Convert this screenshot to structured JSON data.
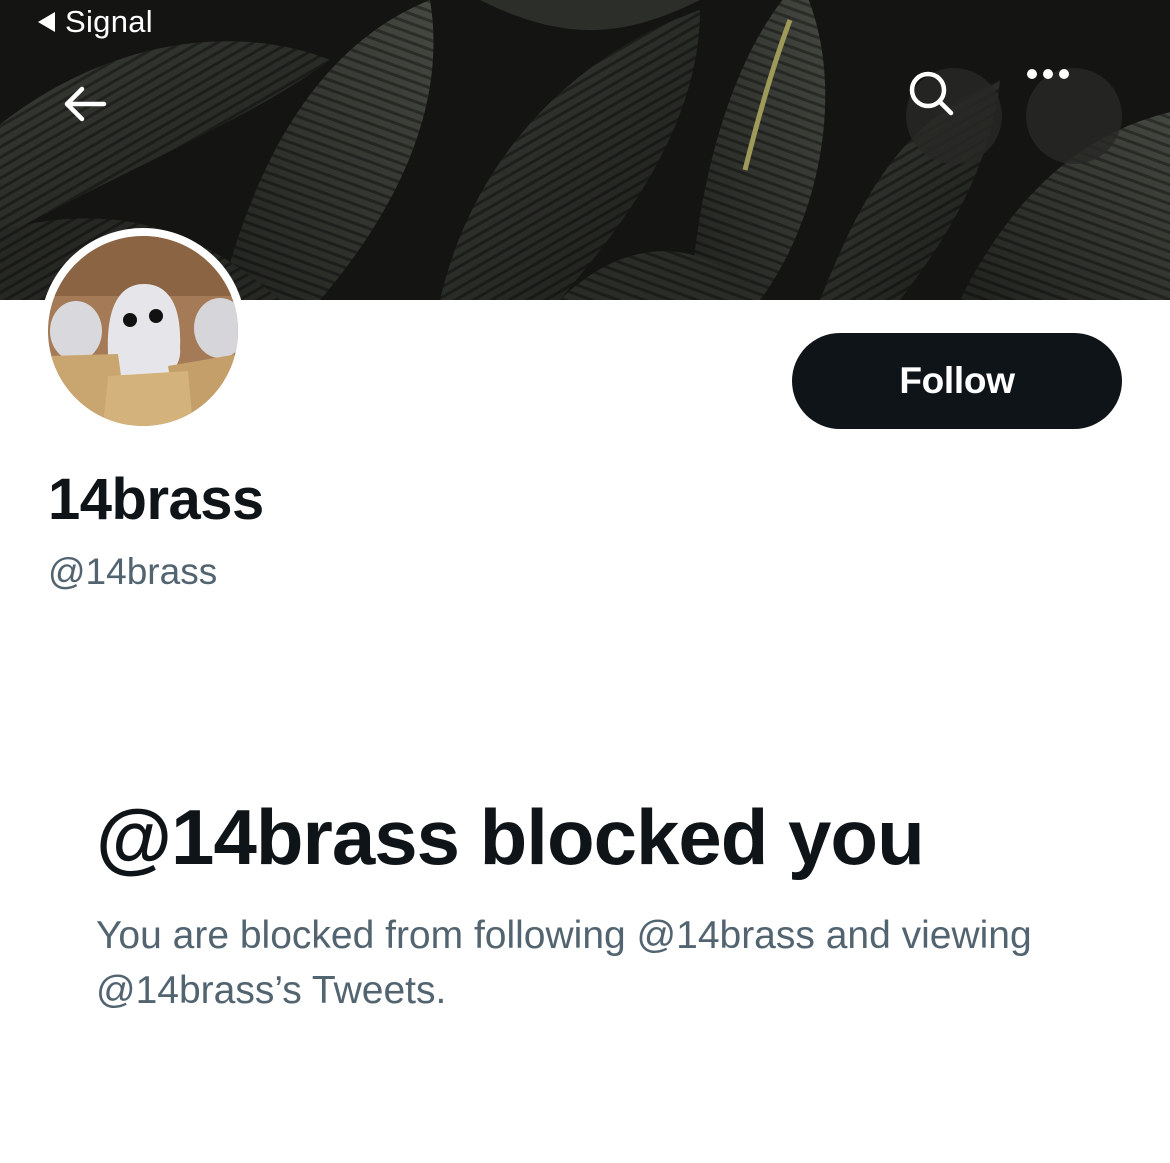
{
  "status_bar": {
    "back_app_label": "Signal"
  },
  "header": {
    "back_icon": "arrow-left-icon",
    "search_icon": "search-icon",
    "more_icon": "more-horizontal-icon"
  },
  "profile": {
    "avatar_description": "avatar",
    "follow_label": "Follow",
    "display_name": "14brass",
    "handle": "@14brass"
  },
  "blocked": {
    "title": "@14brass blocked you",
    "message": "You are blocked from following @14brass and viewing @14brass’s Tweets."
  },
  "colors": {
    "primary_text": "#0f1419",
    "secondary_text": "#536471",
    "follow_button_bg": "#0f1419",
    "banner_bg": "#1b1d1a"
  }
}
